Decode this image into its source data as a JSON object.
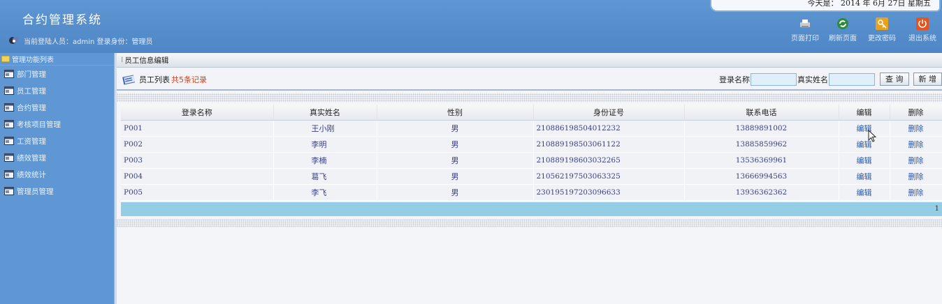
{
  "header": {
    "app_title": "合约管理系统",
    "user_line": "当前登陆人员：admin 登录身份：管理员",
    "date_text": "今天是： 2014 年 6月 27日 星期五",
    "tools": [
      {
        "label": "页面打印",
        "icon": "print-icon"
      },
      {
        "label": "刷新页面",
        "icon": "refresh-icon"
      },
      {
        "label": "更改密码",
        "icon": "key-icon"
      },
      {
        "label": "退出系统",
        "icon": "power-icon"
      }
    ]
  },
  "sidebar": {
    "heading": "管理功能列表",
    "items": [
      {
        "label": "部门管理"
      },
      {
        "label": "员工管理"
      },
      {
        "label": "合约管理"
      },
      {
        "label": "考核项目管理"
      },
      {
        "label": "工资管理"
      },
      {
        "label": "绩效管理"
      },
      {
        "label": "绩效统计"
      },
      {
        "label": "管理员管理"
      }
    ]
  },
  "main": {
    "breadcrumb": "员工信息编辑",
    "list_title": "员工列表",
    "record_count": "共5条记录",
    "search": {
      "login_label": "登录名称",
      "login_value": "",
      "realname_label": "真实姓名",
      "realname_value": "",
      "query_button": "查 询",
      "add_button": "新 增"
    },
    "table": {
      "columns": [
        "登录名称",
        "真实姓名",
        "性别",
        "身份证号",
        "联系电话",
        "编辑",
        "删除"
      ],
      "rows": [
        {
          "login": "P001",
          "name": "王小刚",
          "sex": "男",
          "id": "210886198504012232",
          "phone": "13889891002",
          "edit": "编辑",
          "delete": "删除"
        },
        {
          "login": "P002",
          "name": "李明",
          "sex": "男",
          "id": "210889198503061122",
          "phone": "13885859962",
          "edit": "编辑",
          "delete": "删除"
        },
        {
          "login": "P003",
          "name": "李楠",
          "sex": "男",
          "id": "210889198603032265",
          "phone": "13536369961",
          "edit": "编辑",
          "delete": "删除"
        },
        {
          "login": "P004",
          "name": "葛飞",
          "sex": "男",
          "id": "210562197503063325",
          "phone": "13666994563",
          "edit": "编辑",
          "delete": "删除"
        },
        {
          "login": "P005",
          "name": "李飞",
          "sex": "男",
          "id": "230195197203096633",
          "phone": "13936362362",
          "edit": "编辑",
          "delete": "删除"
        }
      ]
    },
    "pager": "1"
  }
}
